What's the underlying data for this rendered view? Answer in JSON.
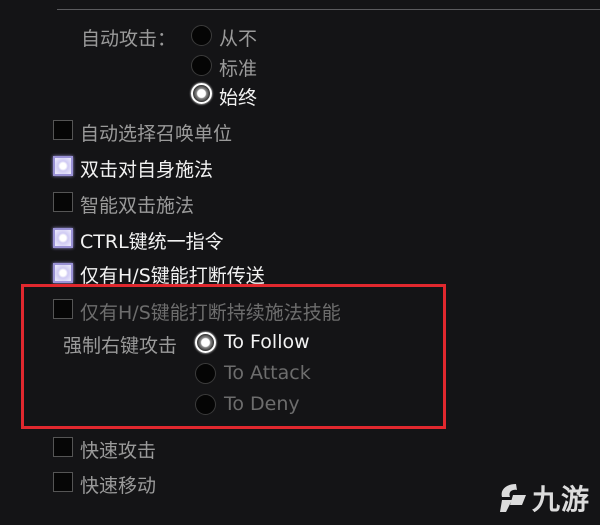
{
  "auto_attack": {
    "label": "自动攻击：",
    "options": [
      "从不",
      "标准",
      "始终"
    ],
    "selected": "始终"
  },
  "checkboxes": [
    {
      "label": "自动选择召唤单位",
      "checked": false
    },
    {
      "label": "双击对自身施法",
      "checked": true
    },
    {
      "label": "智能双击施法",
      "checked": false
    },
    {
      "label": "CTRL键统一指令",
      "checked": true
    },
    {
      "label": "仅有H/S键能打断传送",
      "checked": true
    },
    {
      "label": "仅有H/S键能打断持续施法技能",
      "checked": false
    }
  ],
  "force_right_click": {
    "label": "强制右键攻击",
    "options": [
      "To Follow",
      "To Attack",
      "To Deny"
    ],
    "selected": "To Follow"
  },
  "bottom_checkboxes": [
    {
      "label": "快速攻击",
      "checked": false
    },
    {
      "label": "快速移动",
      "checked": false
    }
  ],
  "watermark": {
    "text": "九游",
    "icon": "jiuyou-logo-icon"
  },
  "colors": {
    "highlight_border": "#e0282e",
    "checkbox_checked": "#9a92d6"
  }
}
